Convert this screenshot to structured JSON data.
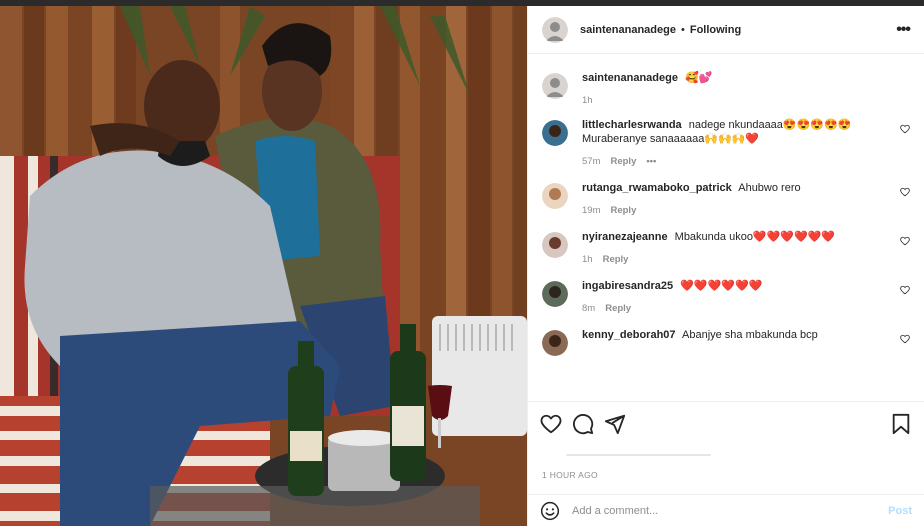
{
  "header": {
    "username": "saintenananadege",
    "separator": "•",
    "follow_status": "Following",
    "more_label": "•••"
  },
  "caption": {
    "username": "saintenananadege",
    "text": "🥰💕",
    "time": "1h"
  },
  "comments": [
    {
      "username": "littlecharlesrwanda",
      "text": "nadege nkundaaaa😍😍😍😍😍 Muraberanye sanaaaaaa🙌🙌🙌❤️",
      "time": "57m",
      "reply_label": "Reply",
      "options_label": "•••",
      "avatar_color": "#3a6f8f"
    },
    {
      "username": "rutanga_rwamaboko_patrick",
      "text": "Ahubwo rero",
      "time": "19m",
      "reply_label": "Reply",
      "avatar_color": "#c9a27d"
    },
    {
      "username": "nyiranezajeanne",
      "text": "Mbakunda ukoo❤️❤️❤️❤️❤️❤️",
      "time": "1h",
      "reply_label": "Reply",
      "avatar_color": "#7a4a3a"
    },
    {
      "username": "ingabiresandra25",
      "text": "❤️❤️❤️❤️❤️❤️",
      "time": "8m",
      "reply_label": "Reply",
      "avatar_color": "#5c6b5a"
    },
    {
      "username": "kenny_deborah07",
      "text": "Abanjye sha mbakunda bcp",
      "time": "",
      "reply_label": "",
      "avatar_color": "#8a6a55"
    }
  ],
  "footer": {
    "time_ago": "1 HOUR AGO",
    "add_comment_placeholder": "Add a comment...",
    "post_label": "Post"
  },
  "colors": {
    "accent": "#0095f6",
    "post_disabled": "#b2dffc",
    "heart": "#e0245e"
  },
  "icons": [
    "heart-icon",
    "comment-icon",
    "share-icon",
    "bookmark-icon",
    "emoji-icon",
    "more-icon"
  ]
}
